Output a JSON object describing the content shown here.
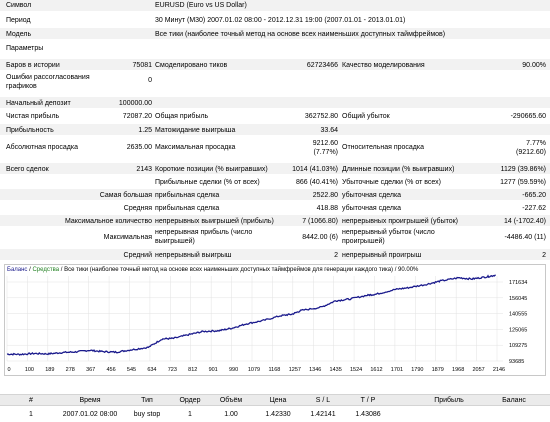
{
  "report": {
    "symbol": {
      "label": "Символ",
      "value": "EURUSD (Euro vs US Dollar)"
    },
    "period": {
      "label": "Период",
      "value": "30 Минут (M30) 2007.01.02 08:00 - 2012.12.31 19:00 (2007.01.01 - 2013.01.01)"
    },
    "model": {
      "label": "Модель",
      "value": "Все тики (наиболее точный метод на основе всех наименьших доступных таймфреймов)"
    },
    "params": {
      "label": "Параметры"
    },
    "bars": {
      "label": "Баров в истории",
      "value": "75081"
    },
    "ticks": {
      "label": "Смоделировано тиков",
      "value": "62723466"
    },
    "quality": {
      "label": "Качество моделирования",
      "value": "90.00%"
    },
    "errors": {
      "label": "Ошибки рассогласования графиков",
      "value": "0"
    },
    "deposit": {
      "label": "Начальный депозит",
      "value": "100000.00"
    },
    "net_profit": {
      "label": "Чистая прибыль",
      "value": "72087.20"
    },
    "gross_profit": {
      "label": "Общая прибыль",
      "value": "362752.80"
    },
    "gross_loss": {
      "label": "Общий убыток",
      "value": "-290665.60"
    },
    "profit_factor": {
      "label": "Прибыльность",
      "value": "1.25"
    },
    "expected": {
      "label": "Матожидание выигрыша",
      "value": "33.64"
    },
    "abs_dd": {
      "label": "Абсолютная просадка",
      "value": "2635.00"
    },
    "max_dd": {
      "label": "Максимальная просадка",
      "value1": "9212.60",
      "value2": "(7.77%)"
    },
    "rel_dd": {
      "label": "Относительная просадка",
      "value1": "7.77%",
      "value2": "(9212.60)"
    },
    "total": {
      "label": "Всего сделок",
      "value": "2143"
    },
    "short": {
      "label": "Короткие позиции (% выигравших)",
      "value": "1014 (41.03%)"
    },
    "long": {
      "label": "Длинные позиции (% выигравших)",
      "value": "1129 (39.86%)"
    },
    "prof_trades": {
      "label": "Прибыльные сделки (% от всех)",
      "value": "866 (40.41%)"
    },
    "loss_trades": {
      "label": "Убыточные сделки (% от всех)",
      "value": "1277 (59.59%)"
    },
    "largest": {
      "label": "Самая большая",
      "sub": "прибыльная сделка",
      "value": "2522.80",
      "sub2": "убыточная сделка",
      "value2": "-665.20"
    },
    "average": {
      "label": "Средняя",
      "sub": "прибыльная сделка",
      "value": "418.88",
      "sub2": "убыточная сделка",
      "value2": "-227.62"
    },
    "max_count": {
      "label": "Максимальное количество",
      "sub": "непрерывных выигрышей (прибыль)",
      "value": "7 (1066.80)",
      "sub2": "непрерывных проигрышей (убыток)",
      "value2": "14 (-1702.40)"
    },
    "maximal": {
      "label": "Максимальная",
      "sub": "непрерывная прибыль (число выигрышей)",
      "value": "8442.00 (6)",
      "sub2": "непрерывный убыток (число проигрышей)",
      "value2": "-4486.40 (11)"
    },
    "avg_cons": {
      "label": "Средний",
      "sub": "непрерывный выигрыш",
      "value": "2",
      "sub2": "непрерывный проигрыш",
      "value2": "2"
    }
  },
  "chart_header": {
    "balance": "Баланс",
    "sep1": " / ",
    "funds": "Средства",
    "sep2": " / ",
    "rest": "Все тики (наиболее точный метод на основе всех наименьших доступных таймфреймов для генерации каждого тика) / 90.00%"
  },
  "colors": {
    "balance_line": "#1a1a8c",
    "funds_text": "#208020",
    "grid": "#e2e2e2"
  },
  "chart_data": {
    "type": "line",
    "series": [
      {
        "name": "Баланс",
        "values": [
          100000,
          99800,
          100600,
          100200,
          101400,
          102000,
          103500,
          102300,
          101800,
          104000,
          106200,
          113900,
          114400,
          118000,
          120800,
          121500,
          124000,
          127800,
          130600,
          135200,
          136600,
          140000,
          143100,
          148900,
          150400,
          154000,
          155000,
          159200,
          160900,
          164000,
          167000,
          170000,
          168900,
          170800,
          172400
        ]
      }
    ],
    "x": [
      0,
      60,
      120,
      180,
      240,
      300,
      360,
      420,
      480,
      545,
      620,
      680,
      730,
      800,
      860,
      930,
      990,
      1050,
      1120,
      1200,
      1250,
      1290,
      1380,
      1440,
      1500,
      1580,
      1620,
      1700,
      1760,
      1840,
      1900,
      1980,
      2040,
      2100,
      2143
    ],
    "xticks": [
      "0",
      "100",
      "189",
      "278",
      "367",
      "456",
      "545",
      "634",
      "723",
      "812",
      "901",
      "990",
      "1079",
      "1168",
      "1257",
      "1346",
      "1435",
      "1524",
      "1612",
      "1701",
      "1790",
      "1879",
      "1968",
      "2057",
      "2146"
    ],
    "yticks": [
      "171634",
      "156045",
      "140555",
      "125065",
      "109275",
      "93685"
    ],
    "ylim": [
      93685,
      171634
    ]
  },
  "table": {
    "headers": [
      "#",
      "Время",
      "Тип",
      "Ордер",
      "Объём",
      "Цена",
      "S / L",
      "T / P",
      "Прибыль",
      "Баланс"
    ],
    "rows": [
      [
        "1",
        "2007.01.02 08:00",
        "buy stop",
        "1",
        "1.00",
        "1.42330",
        "1.42141",
        "1.43086",
        "",
        ""
      ]
    ]
  }
}
